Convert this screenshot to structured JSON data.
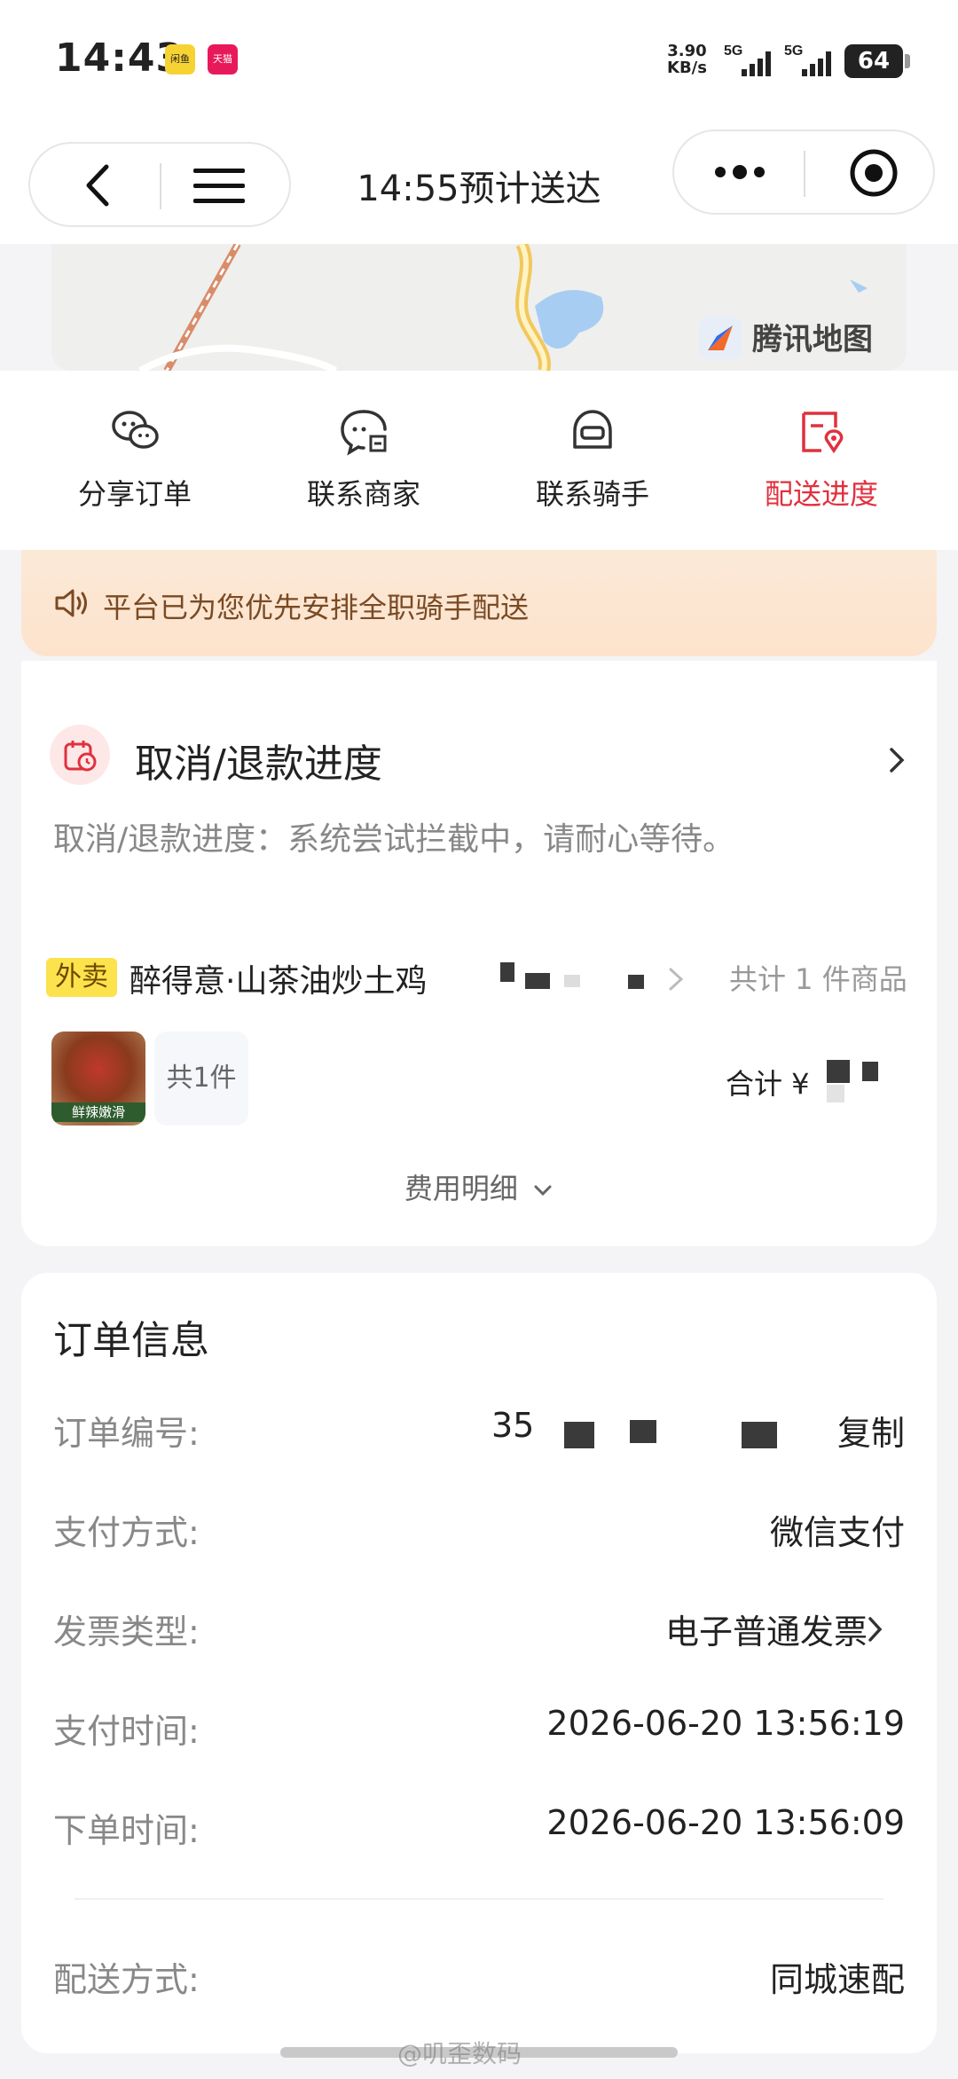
{
  "status_bar": {
    "time": "14:43",
    "app_badge_1": "闲鱼",
    "app_badge_2": "天猫",
    "net_speed_value": "3.90",
    "net_speed_unit": "KB/s",
    "signal_1_label": "5G",
    "signal_2_label": "5G",
    "battery": "64"
  },
  "header": {
    "title": "14:55预计送达"
  },
  "map": {
    "logo_text": "腾讯地图"
  },
  "actions": [
    {
      "label": "分享订单",
      "icon": "wechat-share-icon",
      "active": false
    },
    {
      "label": "联系商家",
      "icon": "store-chat-icon",
      "active": false
    },
    {
      "label": "联系骑手",
      "icon": "rider-helmet-icon",
      "active": false
    },
    {
      "label": "配送进度",
      "icon": "delivery-progress-icon",
      "active": true
    }
  ],
  "notice": {
    "text": "平台已为您优先安排全职骑手配送"
  },
  "refund": {
    "title": "取消/退款进度",
    "description": "取消/退款进度：系统尝试拦截中，请耐心等待。"
  },
  "order": {
    "tag": "外卖",
    "store_name": "醉得意·山茶油炒土鸡",
    "item_count_summary": "共计 1 件商品",
    "thumb_label": "鲜辣嫩滑",
    "quantity": "共1件",
    "total_label": "合计 ¥",
    "fee_detail": "费用明细"
  },
  "order_info": {
    "title": "订单信息",
    "rows": [
      {
        "label": "订单编号:",
        "value": "35",
        "action": "复制"
      },
      {
        "label": "支付方式:",
        "value": "微信支付"
      },
      {
        "label": "发票类型:",
        "value": "电子普通发票"
      },
      {
        "label": "支付时间:",
        "value": "2026-06-20 13:56:19"
      },
      {
        "label": "下单时间:",
        "value": "2026-06-20 13:56:09"
      },
      {
        "label": "配送方式:",
        "value": "同城速配"
      }
    ]
  },
  "watermark": "@叽歪数码",
  "colors": {
    "accent_red": "#e0313e",
    "notice_bg": "#fde3cc",
    "takeout_tag": "#fce24c"
  }
}
